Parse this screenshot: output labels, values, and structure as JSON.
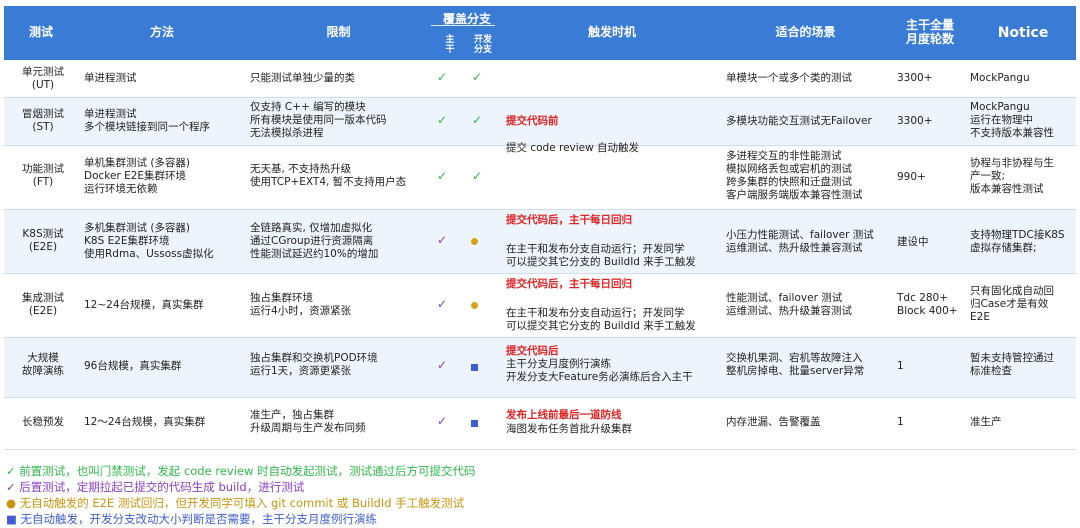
{
  "colors": {
    "header": "#3a7bd5",
    "green": "#2fb84b",
    "purple": "#8a3fc7",
    "gold": "#d6a318",
    "blue": "#3f5fd0",
    "red": "#e02424"
  },
  "header": {
    "test": "测试",
    "method": "方法",
    "limit": "限制",
    "coverage": "覆盖分支",
    "cov_main": "主\n干",
    "cov_dev": "开发\n分支",
    "trigger": "触发时机",
    "scene": "适合的场景",
    "rounds": "主干全量\n月度轮数",
    "notice": "Notice"
  },
  "rows": [
    {
      "test": "单元测试\n(UT)",
      "method": "单进程测试",
      "limit": "只能测试单独少量的类",
      "main": "✓",
      "dev": "✓",
      "scene": "单模块一个或多个类的测试",
      "rounds": "3300+",
      "notice": "MockPangu"
    },
    {
      "test": "冒烟测试\n(ST)",
      "method": "单进程测试\n多个模块链接到同一个程序",
      "limit": "仅支持 C++ 编写的模块\n所有模块是使用同一版本代码\n无法模拟杀进程",
      "main": "✓",
      "dev": "✓",
      "scene": "多模块功能交互测试无Failover",
      "rounds": "3300+",
      "notice": "MockPangu\n运行在物理中\n不支持版本兼容性"
    },
    {
      "test": "功能测试\n(FT)",
      "method": "单机集群测试 (多容器)\nDocker E2E集群环境\n运行环境无依赖",
      "limit": "无天基, 不支持热升级\n使用TCP+EXT4, 暂不支持用户态",
      "main": "✓",
      "dev": "✓",
      "scene": "多进程交互的非性能测试\n模拟网络丢包或宕机的测试\n跨多集群的快照和迁盘测试\n客户端服务端版本兼容性测试",
      "rounds": "990+",
      "notice": "协程与非协程与生\n产一致;\n版本兼容性测试"
    },
    {
      "test": "K8S测试\n(E2E)",
      "method": "多机集群测试 (多容器)\nK8S E2E集群环境\n使用Rdma、Ussoss虚拟化",
      "limit": "全链路真实, 仅增加虚拟化\n通过CGroup进行资源隔离\n性能测试延迟约10%的增加",
      "main": "✓",
      "dev": "●",
      "scene": "小压力性能测试、failover 测试\n运维测试、热升级性兼容测试",
      "rounds": "建设中",
      "notice": "支持物理TDC接K8S\n虚拟存储集群;"
    },
    {
      "test": "集成测试\n(E2E)",
      "method": "12~24台规模，真实集群",
      "limit": "独占集群环境\n运行4小时，资源紧张",
      "main": "✓",
      "dev": "●",
      "scene": "性能测试、failover 测试\n运维测试、热升级兼容测试",
      "rounds": "Tdc 280+\nBlock 400+",
      "notice": "只有固化成自动回\n归Case才是有效\nE2E"
    },
    {
      "test": "大规模\n故障演练",
      "method": "96台规模，真实集群",
      "limit": "独占集群和交换机POD环境\n运行1天，资源更紧张",
      "main": "✓",
      "dev": "■",
      "scene": "交换机果洞、宕机等故障注入\n整机房掉电、批量server异常",
      "rounds": "1",
      "notice": "暂未支持管控通过\n标准检查"
    },
    {
      "test": "长稳预发",
      "method": "12～24台规模，真实集群",
      "limit": "准生产，独占集群\n升级周期与生产发布同频",
      "main": "✓",
      "dev": "■",
      "scene": "内存泄漏、告警覆盖",
      "rounds": "1",
      "notice": "准生产"
    }
  ],
  "triggers": {
    "t1_red": "提交代码前",
    "t1_text": "提交 code review 自动触发",
    "t2_red": "提交代码后，主干每日回归",
    "t2_text": "在主干和发布分支自动运行；开发同学\n可以提交其它分支的 BuildId 来手工触发",
    "t3_red": "提交代码后，主干每日回归",
    "t3_text": "在主干和发布分支自动运行；开发同学\n可以提交其它分支的 BuildId 来手工触发",
    "t4_red": "提交代码后",
    "t4_text": "主干分支月度例行演练\n开发分支大Feature务必演练后合入主干",
    "t5_red": "发布上线前最后一道防线",
    "t5_text": "海图发布任务首批升级集群"
  },
  "legend": [
    "✓ 前置测试，也叫门禁测试，发起 code review 时自动发起测试，测试通过后方可提交代码",
    "✓ 后置测试，定期拉起已提交的代码生成 build，进行测试",
    "● 无自动触发的 E2E 测试回归，但开发同学可填入 git commit 或 BuildId 手工触发测试",
    "■ 无自动触发，开发分支改动大小判断是否需要，主干分支月度例行演练"
  ]
}
